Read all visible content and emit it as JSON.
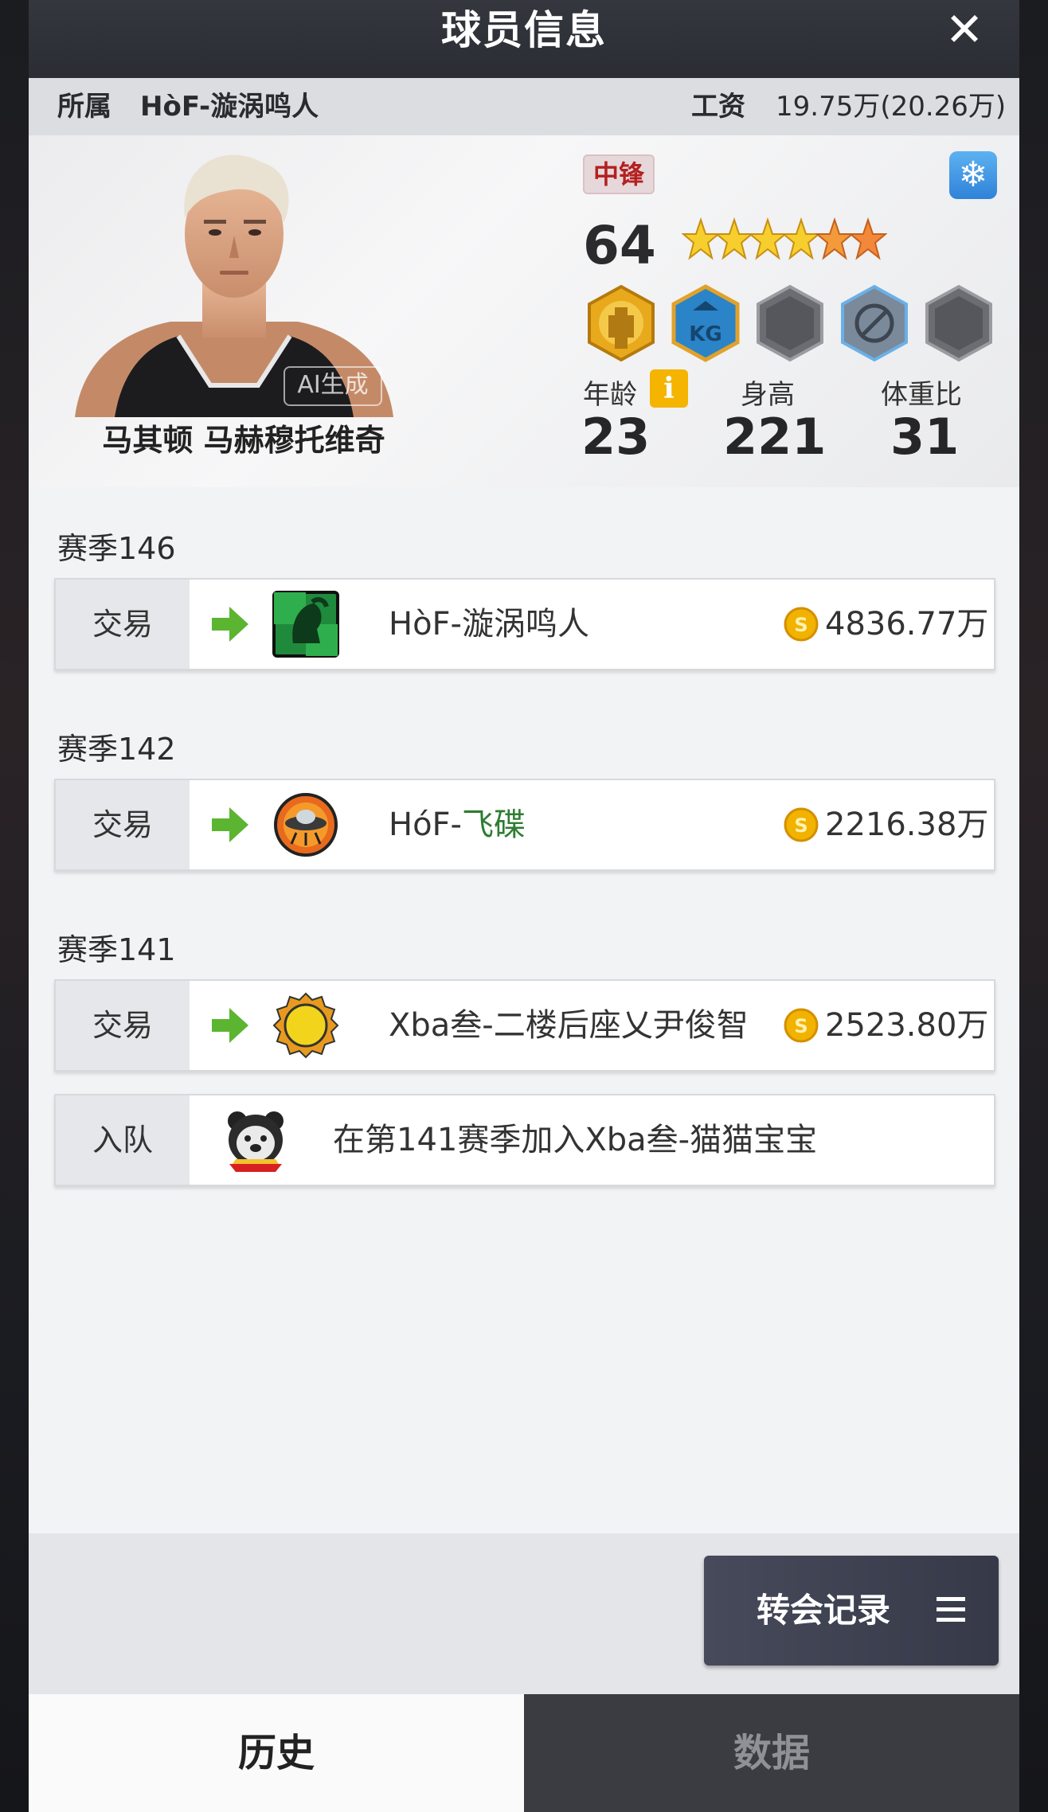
{
  "header": {
    "title": "球员信息",
    "close_symbol": "✕"
  },
  "info": {
    "team_label": "所属",
    "team": "HòF-漩涡鸣人",
    "salary_label": "工资",
    "salary": "19.75万(20.26万)"
  },
  "player": {
    "ai_tag": "AI生成",
    "name": "马其顿 马赫穆托维奇",
    "position": "中锋",
    "rating": "64",
    "star_rating": 5,
    "stats": [
      {
        "label": "年龄",
        "value": "23"
      },
      {
        "label": "身高",
        "value": "221"
      },
      {
        "label": "体重比",
        "value": "31"
      }
    ]
  },
  "history": [
    {
      "season": "赛季146",
      "type": "交易",
      "team": "HòF-漩涡鸣人",
      "fee": "4836.77万"
    },
    {
      "season": "赛季142",
      "type": "交易",
      "team_prefix": "HóF-",
      "team_suffix": "飞碟",
      "fee": "2216.38万"
    },
    {
      "season": "赛季141",
      "type": "交易",
      "team": "Xba叁-二楼后座乂尹俊智",
      "fee": "2523.80万"
    }
  ],
  "join": {
    "type": "入队",
    "text": "在第141赛季加入Xba叁-猫猫宝宝"
  },
  "footer": {
    "transfer_button": "转会记录"
  },
  "tabs": {
    "history": "历史",
    "data": "数据"
  },
  "colors": {
    "accent_green": "#2e7d32",
    "arrow_green": "#5cb531",
    "position_red": "#b42020",
    "coin_gold": "#f2b200"
  }
}
